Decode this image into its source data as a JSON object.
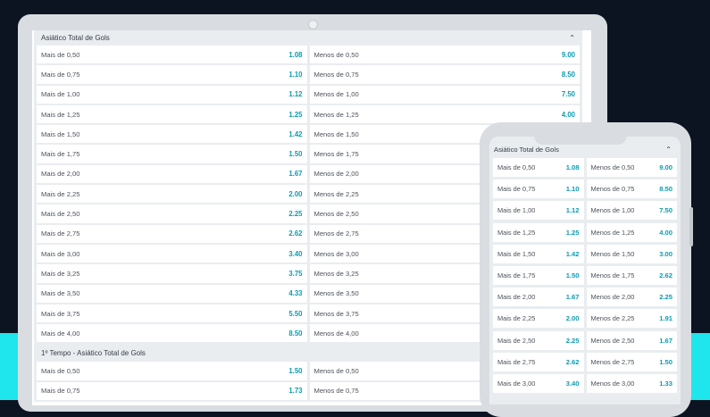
{
  "colors": {
    "background": "#0c1421",
    "accent_band": "#1ee6ec",
    "odds": "#0a9cb2"
  },
  "laptop": {
    "section1": {
      "title": "Asiático Total de Gols",
      "rows": [
        {
          "over": "Mais de 0,50",
          "over_odds": "1.08",
          "under": "Menos de 0,50",
          "under_odds": "9.00"
        },
        {
          "over": "Mais de 0,75",
          "over_odds": "1.10",
          "under": "Menos de 0,75",
          "under_odds": "8.50"
        },
        {
          "over": "Mais de 1,00",
          "over_odds": "1.12",
          "under": "Menos de 1,00",
          "under_odds": "7.50"
        },
        {
          "over": "Mais de 1,25",
          "over_odds": "1.25",
          "under": "Menos de 1,25",
          "under_odds": "4.00"
        },
        {
          "over": "Mais de 1,50",
          "over_odds": "1.42",
          "under": "Menos de 1,50",
          "under_odds": ""
        },
        {
          "over": "Mais de 1,75",
          "over_odds": "1.50",
          "under": "Menos de 1,75",
          "under_odds": ""
        },
        {
          "over": "Mais de 2,00",
          "over_odds": "1.67",
          "under": "Menos de 2,00",
          "under_odds": ""
        },
        {
          "over": "Mais de 2,25",
          "over_odds": "2.00",
          "under": "Menos de 2,25",
          "under_odds": ""
        },
        {
          "over": "Mais de 2,50",
          "over_odds": "2.25",
          "under": "Menos de 2,50",
          "under_odds": ""
        },
        {
          "over": "Mais de 2,75",
          "over_odds": "2.62",
          "under": "Menos de 2,75",
          "under_odds": ""
        },
        {
          "over": "Mais de 3,00",
          "over_odds": "3.40",
          "under": "Menos de 3,00",
          "under_odds": ""
        },
        {
          "over": "Mais de 3,25",
          "over_odds": "3.75",
          "under": "Menos de 3,25",
          "under_odds": ""
        },
        {
          "over": "Mais de 3,50",
          "over_odds": "4.33",
          "under": "Menos de 3,50",
          "under_odds": ""
        },
        {
          "over": "Mais de 3,75",
          "over_odds": "5.50",
          "under": "Menos de 3,75",
          "under_odds": ""
        },
        {
          "over": "Mais de 4,00",
          "over_odds": "8.50",
          "under": "Menos de 4,00",
          "under_odds": ""
        }
      ]
    },
    "section2": {
      "title": "1º Tempo - Asiático Total de Gols",
      "rows": [
        {
          "over": "Mais de 0,50",
          "over_odds": "1.50",
          "under": "Menos de 0,50",
          "under_odds": ""
        },
        {
          "over": "Mais de 0,75",
          "over_odds": "1.73",
          "under": "Menos de 0,75",
          "under_odds": ""
        }
      ]
    }
  },
  "phone": {
    "title": "Asiático Total de Gols",
    "rows": [
      {
        "over": "Mais de 0,50",
        "over_odds": "1.08",
        "under": "Menos de 0,50",
        "under_odds": "9.00"
      },
      {
        "over": "Mais de 0,75",
        "over_odds": "1.10",
        "under": "Menos de 0,75",
        "under_odds": "8.50"
      },
      {
        "over": "Mais de 1,00",
        "over_odds": "1.12",
        "under": "Menos de 1,00",
        "under_odds": "7.50"
      },
      {
        "over": "Mais de 1,25",
        "over_odds": "1.25",
        "under": "Menos de 1,25",
        "under_odds": "4.00"
      },
      {
        "over": "Mais de 1,50",
        "over_odds": "1.42",
        "under": "Menos de 1,50",
        "under_odds": "3.00"
      },
      {
        "over": "Mais de 1,75",
        "over_odds": "1.50",
        "under": "Menos de 1,75",
        "under_odds": "2.62"
      },
      {
        "over": "Mais de 2,00",
        "over_odds": "1.67",
        "under": "Menos de 2,00",
        "under_odds": "2.25"
      },
      {
        "over": "Mais de 2,25",
        "over_odds": "2.00",
        "under": "Menos de 2,25",
        "under_odds": "1.91"
      },
      {
        "over": "Mais de 2,50",
        "over_odds": "2.25",
        "under": "Menos de 2,50",
        "under_odds": "1.67"
      },
      {
        "over": "Mais de 2,75",
        "over_odds": "2.62",
        "under": "Menos de 2,75",
        "under_odds": "1.50"
      },
      {
        "over": "Mais de 3,00",
        "over_odds": "3.40",
        "under": "Menos de 3,00",
        "under_odds": "1.33"
      }
    ]
  }
}
